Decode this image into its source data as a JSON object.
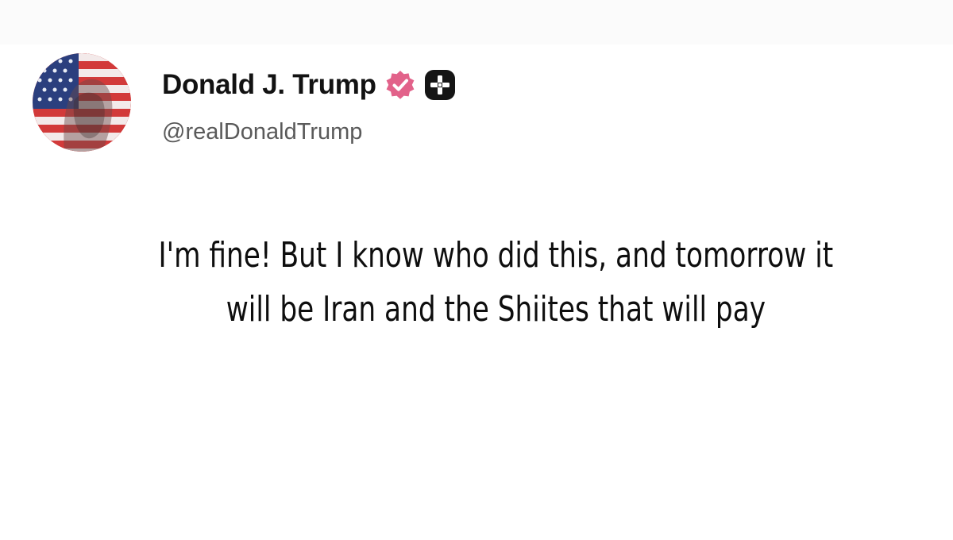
{
  "post": {
    "author": {
      "display_name": "Donald J. Trump",
      "handle": "@realDonaldTrump",
      "avatar_icon": "flag-portrait-avatar",
      "verified_icon": "verified-badge-icon",
      "verified_color": "#e2628a",
      "plus_icon": "plus-badge-icon"
    },
    "text_lines": [
      "I'm fine! But I know who did this, and tomorrow it",
      "will be Iran and the Shiites that will pay"
    ]
  }
}
